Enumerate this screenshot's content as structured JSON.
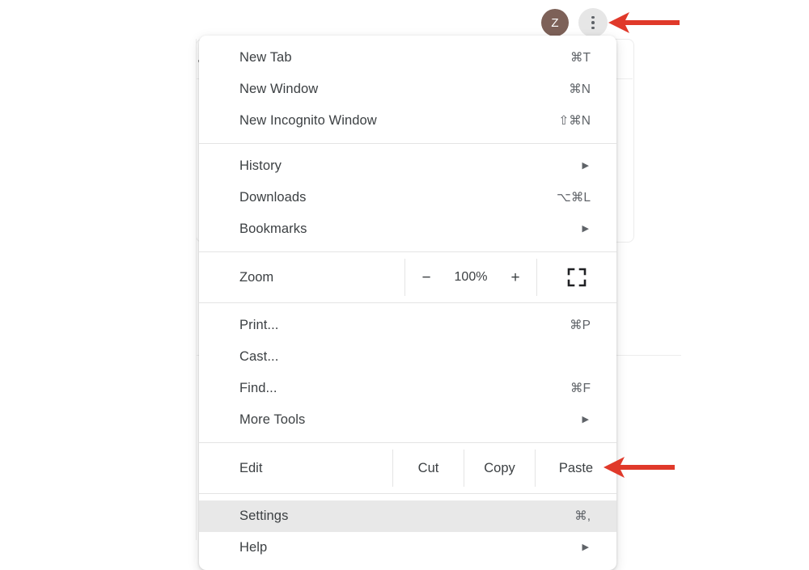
{
  "toolbar": {
    "avatar_initial": "Z",
    "avatar_color": "#7d6158",
    "kebab_name": "Customize and control Google Chrome"
  },
  "annotations": {
    "arrow_color": "#e0392a",
    "arrow_top_target": "kebab-menu-button",
    "arrow_bottom_target": "settings-menu-item"
  },
  "menu": {
    "sections": [
      {
        "items": [
          {
            "label": "New Tab",
            "shortcut": "⌘T",
            "type": "item"
          },
          {
            "label": "New Window",
            "shortcut": "⌘N",
            "type": "item"
          },
          {
            "label": "New Incognito Window",
            "shortcut": "⇧⌘N",
            "type": "item"
          }
        ]
      },
      {
        "items": [
          {
            "label": "History",
            "shortcut": "",
            "type": "submenu"
          },
          {
            "label": "Downloads",
            "shortcut": "⌥⌘L",
            "type": "item"
          },
          {
            "label": "Bookmarks",
            "shortcut": "",
            "type": "submenu"
          }
        ]
      },
      {
        "zoom_row": {
          "label": "Zoom",
          "decrease_label": "−",
          "value": "100%",
          "increase_label": "+",
          "fullscreen_icon": "fullscreen-icon"
        }
      },
      {
        "items": [
          {
            "label": "Print...",
            "shortcut": "⌘P",
            "type": "item"
          },
          {
            "label": "Cast...",
            "shortcut": "",
            "type": "item"
          },
          {
            "label": "Find...",
            "shortcut": "⌘F",
            "type": "item"
          },
          {
            "label": "More Tools",
            "shortcut": "",
            "type": "submenu"
          }
        ]
      },
      {
        "edit_row": {
          "label": "Edit",
          "actions": [
            "Cut",
            "Copy",
            "Paste"
          ]
        }
      },
      {
        "items": [
          {
            "label": "Settings",
            "shortcut": "⌘,",
            "type": "item",
            "highlighted": true
          },
          {
            "label": "Help",
            "shortcut": "",
            "type": "submenu"
          }
        ]
      }
    ]
  }
}
